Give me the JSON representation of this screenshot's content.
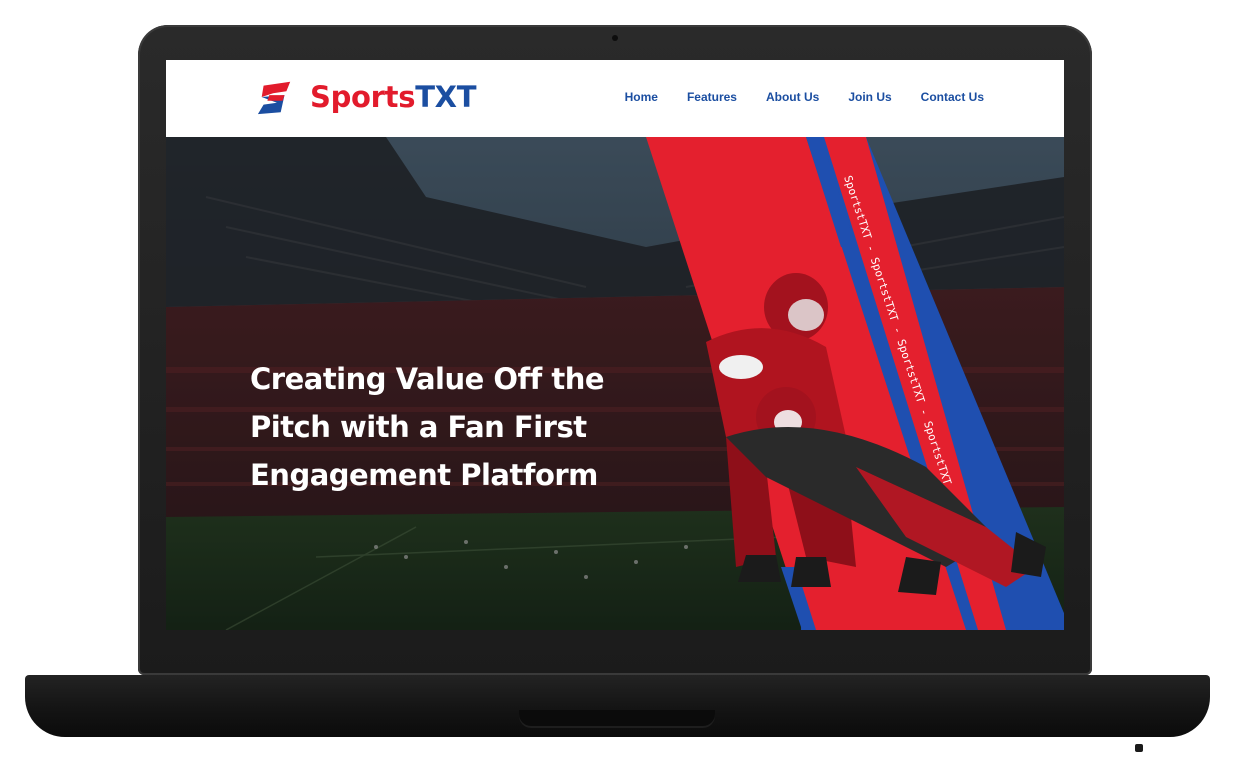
{
  "brand": {
    "name_part1": "Sports",
    "name_part2": "TXT",
    "colors": {
      "red": "#e21b2c",
      "blue": "#1b4ea1"
    },
    "logo_icon": "sportstxt-logo-icon"
  },
  "nav": {
    "items": [
      {
        "label": "Home"
      },
      {
        "label": "Features"
      },
      {
        "label": "About Us"
      },
      {
        "label": "Join Us"
      },
      {
        "label": "Contact Us"
      }
    ]
  },
  "hero": {
    "headline": "Creating Value Off the Pitch with a Fan First Engagement Platform",
    "stripe_text": "SportstTXT - SportstTXT - SportstTXT - SportstTXT",
    "accent_red": "#e4202e",
    "accent_blue": "#1f4fb0",
    "image": "stadium-football-players-image"
  }
}
